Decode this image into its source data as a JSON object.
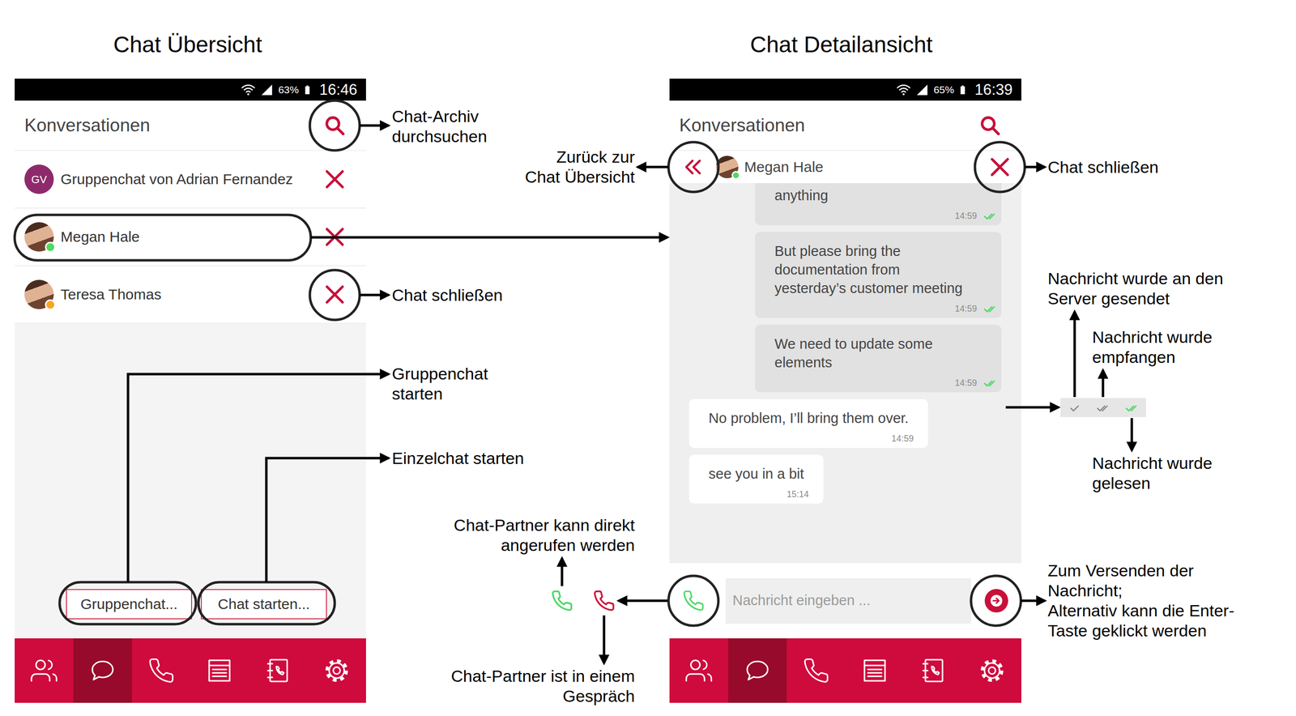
{
  "overview": {
    "title": "Chat Übersicht",
    "status_bar": {
      "battery": "63%",
      "time": "16:46"
    },
    "header": "Konversationen",
    "conversations": [
      {
        "name": "Gruppenchat von Adrian Fernandez",
        "kind": "initials",
        "avatar": "GV"
      },
      {
        "name": "Megan Hale",
        "kind": "photo",
        "color": "#4cd964"
      },
      {
        "name": "Teresa Thomas",
        "kind": "photo",
        "color": "#f5a623"
      }
    ],
    "buttons": [
      "Gruppenchat...",
      "Chat starten..."
    ],
    "nav": [
      {
        "selected": false
      },
      {
        "selected": true
      },
      {
        "selected": false
      },
      {
        "selected": false
      },
      {
        "selected": false
      },
      {
        "selected": false
      }
    ]
  },
  "detail": {
    "title": "Chat Detailansicht",
    "status_bar": {
      "battery": "65%",
      "time": "16:39"
    },
    "header": "Konversationen",
    "partner": {
      "name": "Megan Hale",
      "color": "#4cd964"
    },
    "messages": [
      {
        "kind": "outgoing",
        "text": "anything",
        "time": "14:59",
        "status": "read"
      },
      {
        "kind": "outgoing",
        "text": "But please bring the documentation from yesterday’s customer meeting",
        "time": "14:59",
        "status": "read"
      },
      {
        "kind": "outgoing",
        "text": "We need to update some elements",
        "time": "14:59",
        "status": "read"
      },
      {
        "kind": "incoming",
        "text": "No problem, I’ll bring them over.",
        "time": "14:59"
      },
      {
        "kind": "incoming",
        "text": "see you in a bit",
        "time": "15:14"
      }
    ],
    "input": {
      "placeholder": "Nachricht eingeben ..."
    },
    "nav": [
      {
        "selected": false
      },
      {
        "selected": true
      },
      {
        "selected": false
      },
      {
        "selected": false
      },
      {
        "selected": false
      },
      {
        "selected": false
      }
    ]
  },
  "tick_legend": [
    {
      "status": "sent",
      "kind": "single",
      "color": "#8a8a8a"
    },
    {
      "status": "received",
      "kind": "double",
      "color": "#8a8a8a"
    },
    {
      "status": "read",
      "kind": "double",
      "color": "#4cd964"
    }
  ],
  "call_states": [
    {
      "color": "#4cd964"
    },
    {
      "color": "#d0103a"
    }
  ],
  "annotations": [
    {
      "text": "Chat-Archiv\ndurchsuchen"
    },
    {
      "text": "Chat schließen"
    },
    {
      "text": "Gruppenchat\nstarten"
    },
    {
      "text": "Einzelchat starten"
    },
    {
      "text": "Zurück zur\nChat Übersicht"
    },
    {
      "text": "Chat schließen"
    },
    {
      "text": "Nachricht wurde an den\nServer gesendet"
    },
    {
      "text": "Nachricht wurde\nempfangen"
    },
    {
      "text": "Nachricht wurde\ngelesen"
    },
    {
      "text": "Chat-Partner kann direkt\nangerufen werden"
    },
    {
      "text": "Chat-Partner ist in einem\nGespräch"
    },
    {
      "text": "Zum Versenden der\nNachricht;\nAlternativ kann die Enter-\nTaste geklickt werden"
    }
  ]
}
